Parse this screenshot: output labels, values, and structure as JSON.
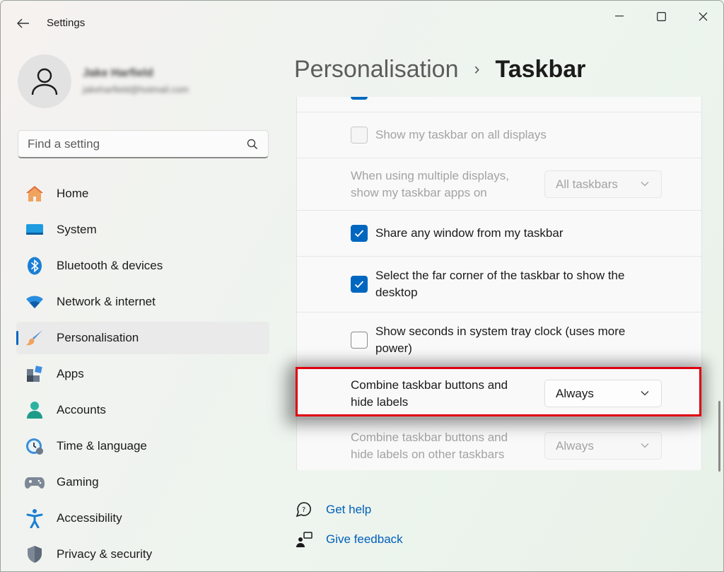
{
  "app": {
    "title": "Settings"
  },
  "profile": {
    "name": "Jake Harfield",
    "email": "jakeharfield@hotmail.com"
  },
  "search": {
    "placeholder": "Find a setting"
  },
  "sidebar": {
    "items": [
      {
        "label": "Home",
        "icon": "home-icon"
      },
      {
        "label": "System",
        "icon": "system-icon"
      },
      {
        "label": "Bluetooth & devices",
        "icon": "bluetooth-icon"
      },
      {
        "label": "Network & internet",
        "icon": "wifi-icon"
      },
      {
        "label": "Personalisation",
        "icon": "brush-icon",
        "selected": true
      },
      {
        "label": "Apps",
        "icon": "apps-icon"
      },
      {
        "label": "Accounts",
        "icon": "person-icon"
      },
      {
        "label": "Time & language",
        "icon": "clock-globe-icon"
      },
      {
        "label": "Gaming",
        "icon": "gamepad-icon"
      },
      {
        "label": "Accessibility",
        "icon": "accessibility-icon"
      },
      {
        "label": "Privacy & security",
        "icon": "shield-icon"
      }
    ]
  },
  "header": {
    "parent": "Personalisation",
    "separator": "›",
    "current": "Taskbar"
  },
  "settings": {
    "show_on_all_displays": {
      "label": "Show my taskbar on all displays",
      "checked": false,
      "disabled": true
    },
    "multi_display_apps": {
      "label_line1": "When using multiple displays,",
      "label_line2": "show my taskbar apps on",
      "value": "All taskbars",
      "disabled": true
    },
    "share_window": {
      "label": "Share any window from my taskbar",
      "checked": true
    },
    "far_corner": {
      "label_line1": "Select the far corner of the taskbar to show the",
      "label_line2": "desktop",
      "checked": true
    },
    "show_seconds": {
      "label_line1": "Show seconds in system tray clock (uses more",
      "label_line2": "power)",
      "checked": false
    },
    "combine_buttons": {
      "label_line1": "Combine taskbar buttons and",
      "label_line2": "hide labels",
      "value": "Always"
    },
    "combine_other": {
      "label_line1": "Combine taskbar buttons and",
      "label_line2": "hide labels on other taskbars",
      "value": "Always",
      "disabled": true
    }
  },
  "links": {
    "help": "Get help",
    "feedback": "Give feedback"
  },
  "colors": {
    "accent": "#0067c0",
    "highlight": "#e0000f",
    "link": "#0060b8"
  }
}
